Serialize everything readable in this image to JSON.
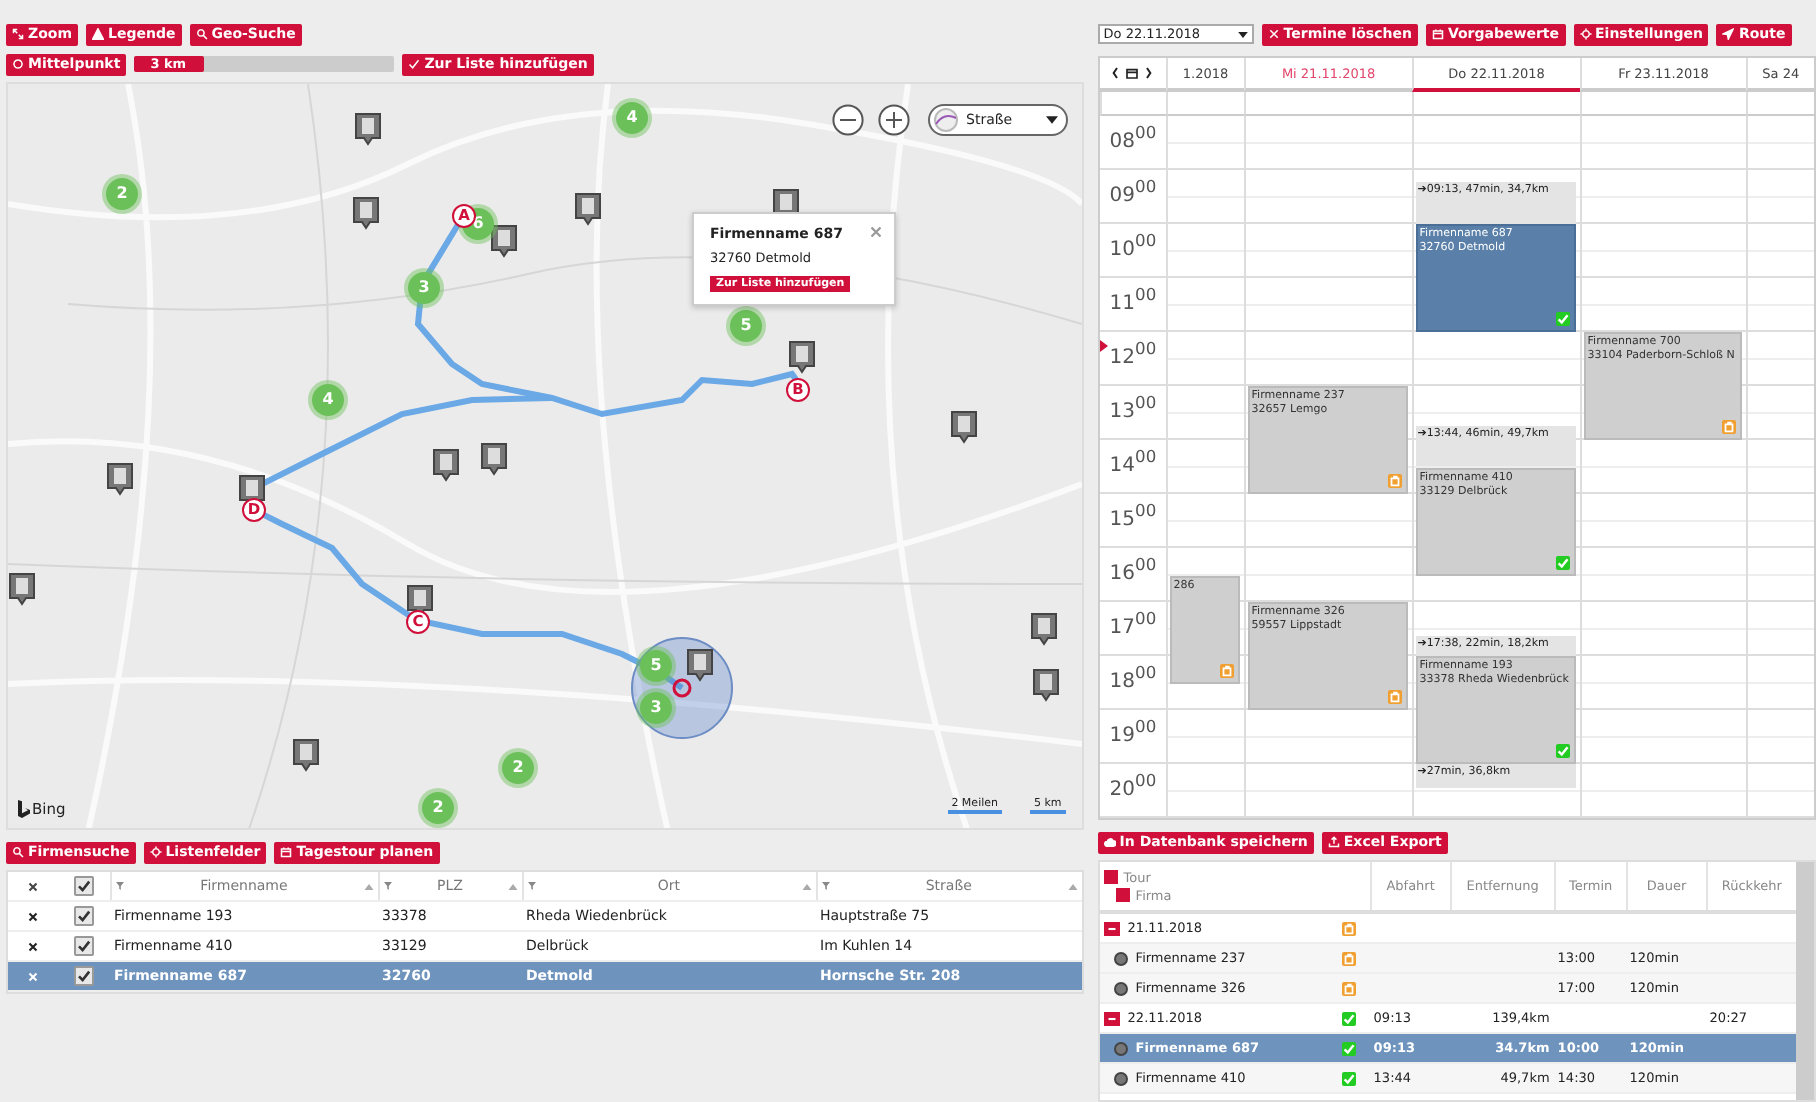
{
  "map_toolbar": [
    "Zoom",
    "Legende",
    "Geo-Suche"
  ],
  "search_bar": {
    "center_button": "Mittelpunkt",
    "radius": {
      "reading": "3 km",
      "level": 0.27
    },
    "add_button": "Zur Liste hinzufügen"
  },
  "map": {
    "layer": "Straße",
    "clusters": [
      "4",
      "2",
      "6",
      "3",
      "5",
      "4",
      "5",
      "3",
      "2",
      "2"
    ],
    "stops": [
      "A",
      "B",
      "D",
      "C"
    ],
    "popup": {
      "title": "Firmenname 687",
      "address": "32760 Detmold",
      "button": "Zur Liste hinzufügen"
    },
    "attribution": "Bing",
    "scale": [
      "2 Meilen",
      "5 km"
    ]
  },
  "calendar": {
    "date_select": "Do 22.11.2018",
    "buttons": [
      "Termine löschen",
      "Vorgabewerte",
      "Einstellungen",
      "Route"
    ],
    "columns": [
      {
        "label": "1.2018",
        "today": false,
        "selected": false
      },
      {
        "label": "Mi 21.11.2018",
        "today": true,
        "selected": false
      },
      {
        "label": "Do 22.11.2018",
        "today": false,
        "selected": true
      },
      {
        "label": "Fr 23.11.2018",
        "today": false,
        "selected": false
      },
      {
        "label": "Sa 24",
        "today": false,
        "selected": false
      }
    ],
    "hours": [
      "08$^{00}$",
      "09$^{00}$",
      "10$^{00}$",
      "11$^{00}$",
      "12$^{00}$",
      "13$^{00}$",
      "14$^{00}$",
      "15$^{00}$",
      "16$^{00}$",
      "17$^{00}$",
      "18$^{00}$",
      "19$^{00}$",
      "20$^{00}$"
    ],
    "events": [
      {
        "kind": "travel",
        "text": "➔09:13, 47min, 34,7km"
      },
      {
        "kind": "appointment",
        "title": "Firmenname 687",
        "place": "32760 Detmold",
        "confirmed": true,
        "selected": true
      },
      {
        "kind": "appointment",
        "title": "Firmenname 700",
        "place": "33104 Paderborn-Schloß N",
        "confirmed": false,
        "selected": false
      },
      {
        "kind": "appointment",
        "title": "Firmenname 237",
        "place": "32657 Lemgo",
        "confirmed": false,
        "selected": false
      },
      {
        "kind": "travel",
        "text": "➔13:44, 46min, 49,7km"
      },
      {
        "kind": "appointment",
        "title": "Firmenname 410",
        "place": "33129 Delbrück",
        "confirmed": true,
        "selected": false
      },
      {
        "kind": "appointment",
        "title": "286",
        "confirmed": false,
        "selected": false
      },
      {
        "kind": "appointment",
        "title": "Firmenname 326",
        "place": "59557 Lippstadt",
        "confirmed": false,
        "selected": false
      },
      {
        "kind": "travel",
        "text": "➔17:38, 22min, 18,2km"
      },
      {
        "kind": "appointment",
        "title": "Firmenname 193",
        "place": "33378 Rheda Wiedenbrück",
        "confirmed": true,
        "selected": false
      },
      {
        "kind": "travel",
        "text": "➔27min, 36,8km"
      }
    ]
  },
  "company_panel": {
    "buttons": [
      "Firmensuche",
      "Listenfelder",
      "Tagestour planen"
    ],
    "columns": [
      "Firmenname",
      "PLZ",
      "Ort",
      "Straße"
    ],
    "header_checked": true,
    "rows": [
      {
        "cells": [
          "Firmenname 193",
          "33378",
          "Rheda Wiedenbrück",
          "Hauptstraße 75"
        ],
        "checked": true,
        "selected": false
      },
      {
        "cells": [
          "Firmenname 410",
          "33129",
          "Delbrück",
          "Im Kuhlen 14"
        ],
        "checked": true,
        "selected": false
      },
      {
        "cells": [
          "Firmenname 687",
          "32760",
          "Detmold",
          "Hornsche Str. 208"
        ],
        "checked": true,
        "selected": true
      }
    ]
  },
  "tour_panel": {
    "buttons": [
      "In Datenbank speichern",
      "Excel Export"
    ],
    "tour_column": "Tour",
    "company_column": "Firma",
    "columns": [
      "Abfahrt",
      "Entfernung",
      "Termin",
      "Dauer",
      "Rückkehr"
    ],
    "groups": [
      {
        "date": "21.11.2018",
        "expanded": true,
        "confirmed": false,
        "children": [
          {
            "name": "Firmenname 237",
            "confirmed": false,
            "selected": false,
            "time": "13:00",
            "duration": "120min"
          },
          {
            "name": "Firmenname 326",
            "confirmed": false,
            "selected": false,
            "time": "17:00",
            "duration": "120min"
          }
        ]
      },
      {
        "date": "22.11.2018",
        "expanded": true,
        "confirmed": true,
        "departure": "09:13",
        "distance": "139,4km",
        "return": "20:27",
        "children": [
          {
            "name": "Firmenname 687",
            "confirmed": true,
            "selected": true,
            "departure": "09:13",
            "distance": "34.7km",
            "time": "10:00",
            "duration": "120min"
          },
          {
            "name": "Firmenname 410",
            "confirmed": true,
            "selected": false,
            "departure": "13:44",
            "distance": "49,7km",
            "time": "14:30",
            "duration": "120min"
          }
        ]
      }
    ]
  }
}
